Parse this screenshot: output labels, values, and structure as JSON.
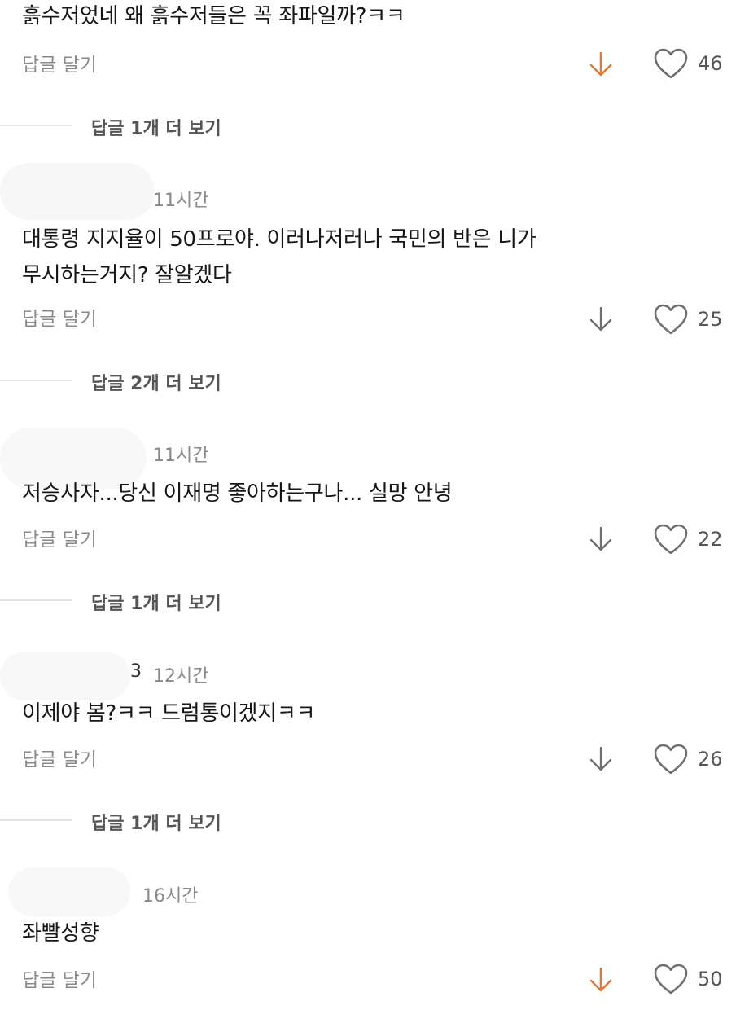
{
  "comments": [
    {
      "username": "",
      "time": "",
      "text_lines": [
        "흙수저었네 왜 흙수저들은 꼭 좌파일까?ㅋㅋ"
      ],
      "reply_label": "답글 달기",
      "likes": "46",
      "downvoted": true,
      "more_replies": "답글 1개 더 보기"
    },
    {
      "username": "",
      "time": "11시간",
      "text_lines": [
        "대통령 지지율이 50프로야. 이러나저러나 국민의 반은 니가",
        "무시하는거지? 잘알겠다"
      ],
      "reply_label": "답글 달기",
      "likes": "25",
      "downvoted": false,
      "more_replies": "답글 2개 더 보기"
    },
    {
      "username": "",
      "time": "11시간",
      "text_lines": [
        "저승사자...당신 이재명 좋아하는구나... 실망  안녕"
      ],
      "reply_label": "답글 달기",
      "likes": "22",
      "downvoted": false,
      "more_replies": "답글 1개 더 보기"
    },
    {
      "username": "3",
      "time": "12시간",
      "text_lines": [
        "이제야 봄?ㅋㅋ 드럼통이겠지ㅋㅋ"
      ],
      "reply_label": "답글 달기",
      "likes": "26",
      "downvoted": false,
      "more_replies": "답글 1개 더 보기"
    },
    {
      "username": "",
      "time": "16시간",
      "text_lines": [
        "좌빨성향"
      ],
      "reply_label": "답글 달기",
      "likes": "50",
      "downvoted": true,
      "more_replies": ""
    }
  ],
  "icons": {
    "downvote": "arrow-down-icon",
    "like": "heart-outline-icon"
  },
  "colors": {
    "downvote_active": "#e07b39",
    "icon_inactive": "#6f6f6f",
    "text": "#161616",
    "muted": "#8a8a8a"
  }
}
